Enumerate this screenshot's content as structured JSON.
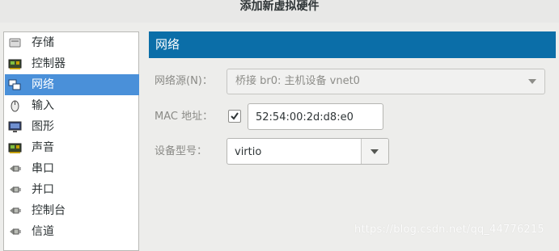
{
  "window": {
    "title": "添加新虚拟硬件"
  },
  "sidebar": {
    "items": [
      {
        "label": "存储",
        "icon": "storage-icon",
        "selected": false
      },
      {
        "label": "控制器",
        "icon": "controller-chip-icon",
        "selected": false
      },
      {
        "label": "网络",
        "icon": "network-icon",
        "selected": true
      },
      {
        "label": "输入",
        "icon": "mouse-icon",
        "selected": false
      },
      {
        "label": "图形",
        "icon": "monitor-icon",
        "selected": false
      },
      {
        "label": "声音",
        "icon": "sound-chip-icon",
        "selected": false
      },
      {
        "label": "串口",
        "icon": "serial-plug-icon",
        "selected": false
      },
      {
        "label": "并口",
        "icon": "parallel-plug-icon",
        "selected": false
      },
      {
        "label": "控制台",
        "icon": "console-plug-icon",
        "selected": false
      },
      {
        "label": "信道",
        "icon": "channel-plug-icon",
        "selected": false
      }
    ]
  },
  "panel": {
    "header": "网络",
    "network_source": {
      "label": "网络源(N)：",
      "value": "桥接 br0: 主机设备 vnet0"
    },
    "mac": {
      "label": "MAC 地址：",
      "checked": true,
      "value": "52:54:00:2d:d8:e0"
    },
    "device_model": {
      "label": "设备型号：",
      "value": "virtio"
    }
  },
  "watermark": "https://blog.csdn.net/qq_44776215",
  "colors": {
    "header_bg": "#0b6ea8",
    "selection_bg": "#4a90d9"
  }
}
